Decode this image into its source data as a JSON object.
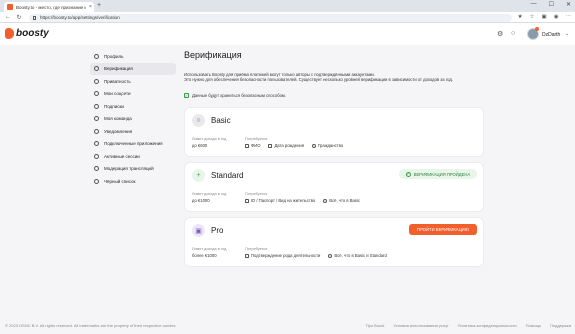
{
  "browser": {
    "tab_title": "Boosty.to - место, где признание и поддержка",
    "tab_close": "×",
    "new_tab": "+",
    "url": "https://boosty.to/app/settings/verification",
    "window_controls": [
      "—",
      "☐",
      "✕"
    ],
    "nav_icons": [
      "back-icon",
      "forward-icon",
      "reload-icon"
    ],
    "toolbar_icons": [
      "extensions-icon",
      "favorites-icon",
      "menu-icon"
    ]
  },
  "header": {
    "logo_text": "boosty",
    "icons": [
      "bell-icon",
      "chat-icon"
    ],
    "username": "DzDarth",
    "chevron": "⌄"
  },
  "sidebar": {
    "items": [
      {
        "label": "Профиль",
        "icon": "settings-icon"
      },
      {
        "label": "Верификация",
        "icon": "user-check-icon",
        "active": true
      },
      {
        "label": "Приватность",
        "icon": "shield-icon"
      },
      {
        "label": "Мои соцсети",
        "icon": "globe-icon"
      },
      {
        "label": "Подписки",
        "icon": "star-icon"
      },
      {
        "label": "Моя команда",
        "icon": "team-icon"
      },
      {
        "label": "Уведомления",
        "icon": "bell-icon"
      },
      {
        "label": "Подключенные приложения",
        "icon": "apps-icon"
      },
      {
        "label": "Активные сессии",
        "icon": "monitor-icon"
      },
      {
        "label": "Модерация трансляций",
        "icon": "broadcast-icon"
      },
      {
        "label": "Чёрный список",
        "icon": "block-icon"
      }
    ]
  },
  "main": {
    "title": "Верификация",
    "description_line1": "Использовать Boosty для приёма платежей могут только авторы с подтверждёнными аккаунтами.",
    "description_line2": "Это нужно для обеспечения безопасности пользователей. Существует несколько уровней верификации в зависимости от доходов за год.",
    "secure_note": "Данные будут храниться безопасным способом.",
    "limit_label": "Лимит дохода в год",
    "requirements_label": "Потребуется",
    "levels": [
      {
        "name": "Basic",
        "icon": "lock-icon",
        "icon_color": "#e9e9ed",
        "limit": "до €600",
        "requirements": [
          "ФИО",
          "Дата рождения",
          "Гражданство"
        ]
      },
      {
        "name": "Standard",
        "icon": "plus-icon",
        "icon_color": "#e8f6ea",
        "limit": "до €1000",
        "requirements": [
          "ID / Паспорт / Вид на жительство",
          "Всё, что в Basic"
        ],
        "status": "ВЕРИФИКАЦИЯ ПРОЙДЕНА"
      },
      {
        "name": "Pro",
        "icon": "briefcase-icon",
        "icon_color": "#ece6f7",
        "limit": "более €1000",
        "requirements": [
          "Подтверждение рода деятельности",
          "Всё, что в Basic и Standard"
        ],
        "action": "ПРОЙТИ ВЕРИФИКАЦИЮ"
      }
    ]
  },
  "footer": {
    "copyright": "© 2023 OSNC B.V. All rights reserved. All trademarks are the property of their respective owners.",
    "links": [
      "Про Boost",
      "Условия использования услуг",
      "Политика конфиденциальности",
      "Помощь",
      "Поддержка"
    ]
  },
  "colors": {
    "brand": "#f15f2c",
    "success": "#3a9a4a",
    "success_bg": "#e8f6ea"
  }
}
